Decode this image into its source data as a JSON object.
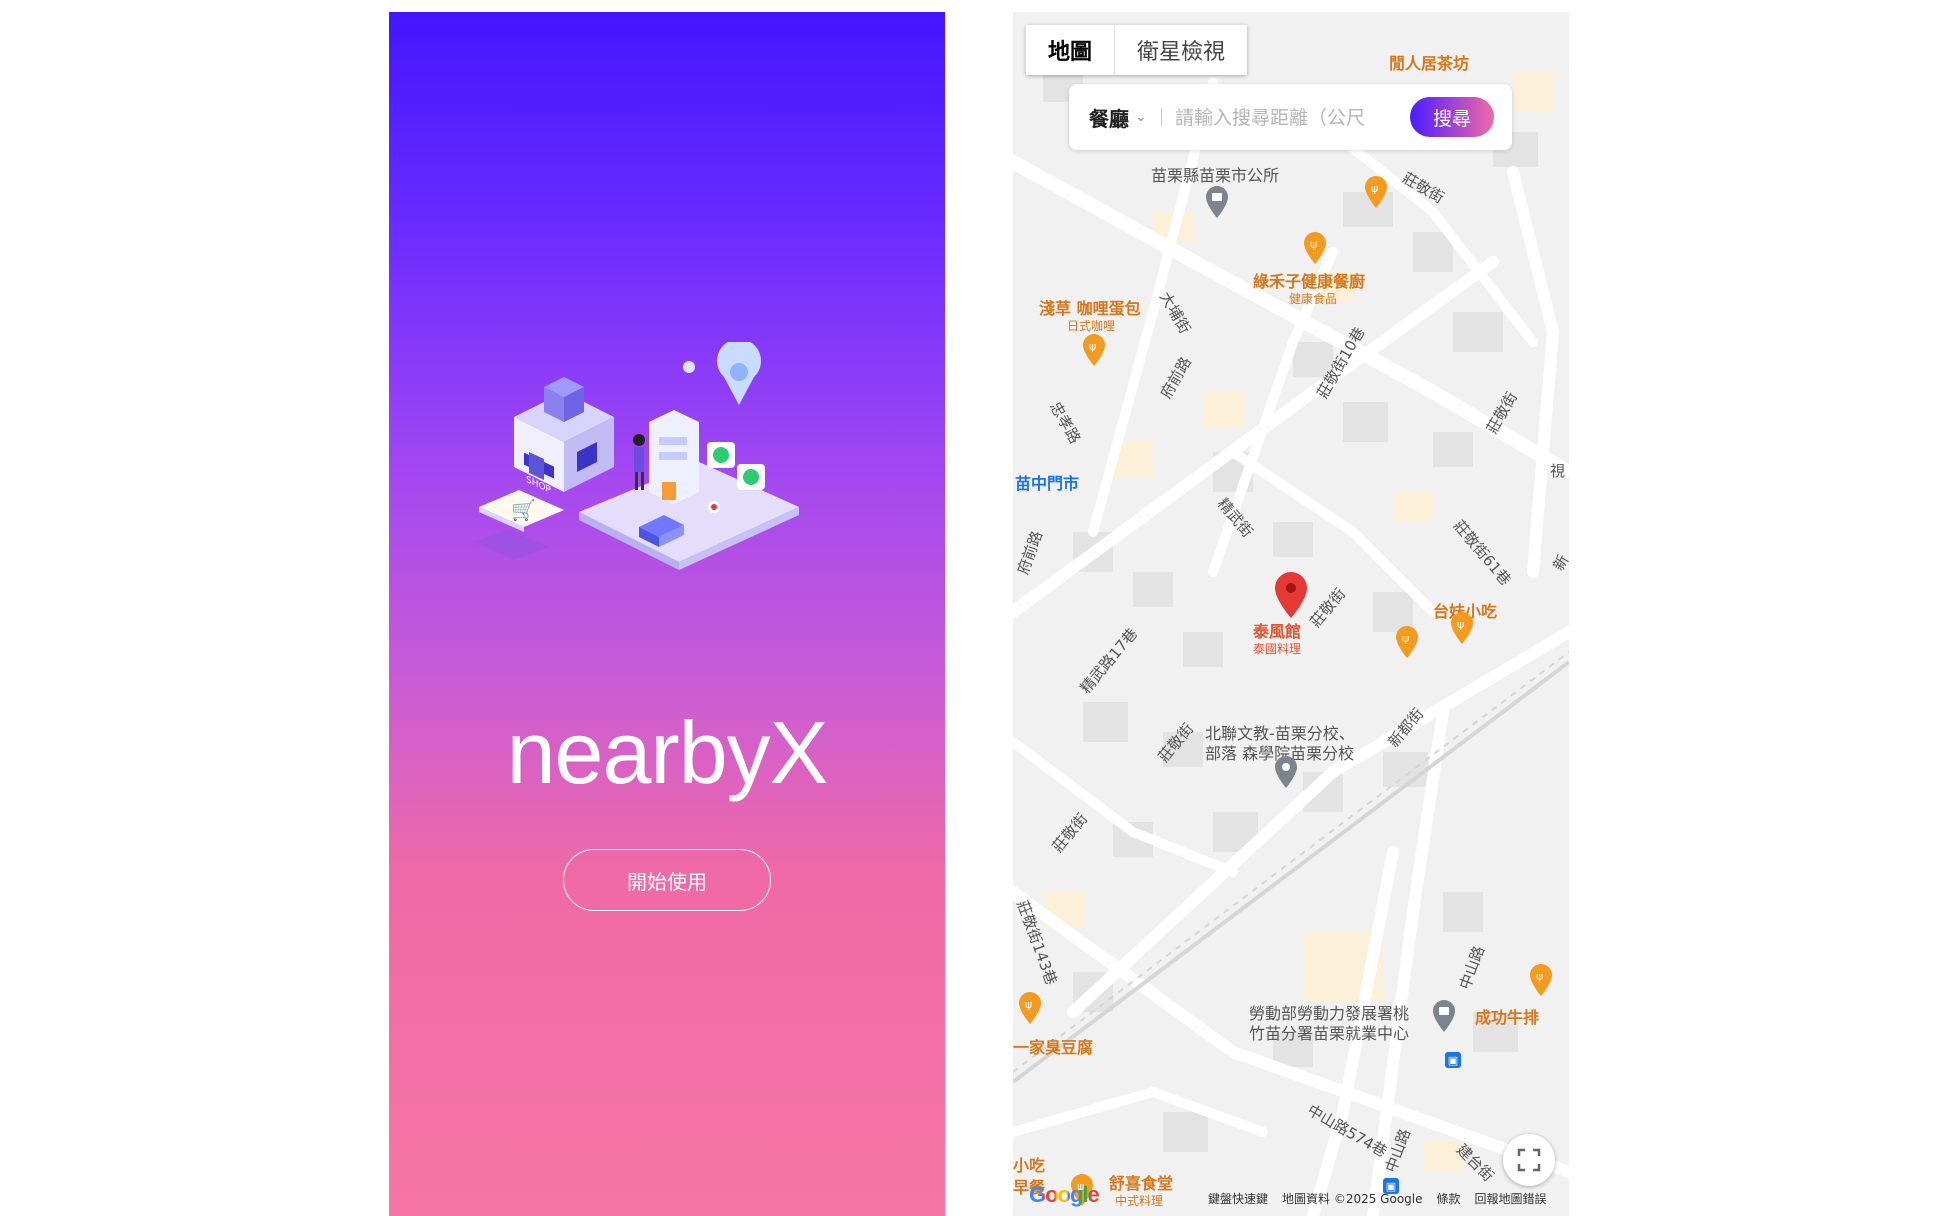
{
  "splash": {
    "title": "nearbyX",
    "start_button": "開始使用",
    "illustration_text": "SHOP"
  },
  "map": {
    "tabs": [
      {
        "label": "地圖",
        "active": true
      },
      {
        "label": "衛星檢視",
        "active": false
      }
    ],
    "search": {
      "category": "餐廳",
      "placeholder": "請輸入搜尋距離（公尺",
      "button": "搜尋"
    },
    "labels": {
      "xianju": "閒人居茶坊",
      "county_office": "苗栗縣苗栗市公所",
      "zhuangjing_st": "莊敬街",
      "lvhezi": "綠禾子健康餐廚",
      "lvhezi_sub": "健康食品",
      "asakusa": "淺草 咖哩蛋包",
      "asakusa_sub": "日式咖哩",
      "dapu_st": "大埔街",
      "fuqian_rd": "府前路",
      "zhongxiao_rd": "忠孝路",
      "zhuangjing_10": "莊敬街10巷",
      "zhuangjing_b": "莊敬街",
      "miao_market": "苗中門市",
      "fuqian_rd2": "府前路",
      "jingwu_st": "精武街",
      "zhuangjing_61": "莊敬街61巷",
      "shi": "視",
      "xin": "新",
      "taifeng": "泰風館",
      "taifeng_sub": "泰國料理",
      "zhuangjing_c": "莊敬街",
      "taimei": "台妹小吃",
      "jingwu_17": "精武路17巷",
      "beilian": "北聯文教-苗栗分校、",
      "beilian2": "部落 森學院苗栗分校",
      "zhuangjing_d": "莊敬街",
      "xindu_st": "新都街",
      "zhuangjing_e": "莊敬街",
      "zhuangjing_143": "莊敬街143巷",
      "zhongshan_rd": "中山路",
      "chenggong": "成功牛排",
      "labor": "勞動部勞動力發展署桃",
      "labor2": "竹苗分署苗栗就業中心",
      "yijia": "一家臭豆腐",
      "zhongshan_574": "中山路574巷",
      "zhongshan_rd2": "中山路",
      "jiantai_st": "建台街",
      "xiaochi": "小吃",
      "zao": "早餐",
      "shuxi": "舒喜食堂",
      "shuxi_sub": "中式料理"
    },
    "footer": [
      "鍵盤快速鍵",
      "地圖資料 ©2025 Google",
      "條款",
      "回報地圖錯誤"
    ],
    "google_logo": "Google",
    "icons": [
      "restaurant-pin-icon",
      "landmark-pin-icon",
      "selected-location-pin-icon",
      "bus-stop-icon",
      "fullscreen-icon"
    ]
  },
  "colors": {
    "gradient_top": "#4316ff",
    "gradient_bottom": "#f576a4",
    "food_label": "#d7771a",
    "pin_red": "#e53935",
    "search_btn_start": "#4a1cff",
    "search_btn_end": "#f06aa5"
  }
}
